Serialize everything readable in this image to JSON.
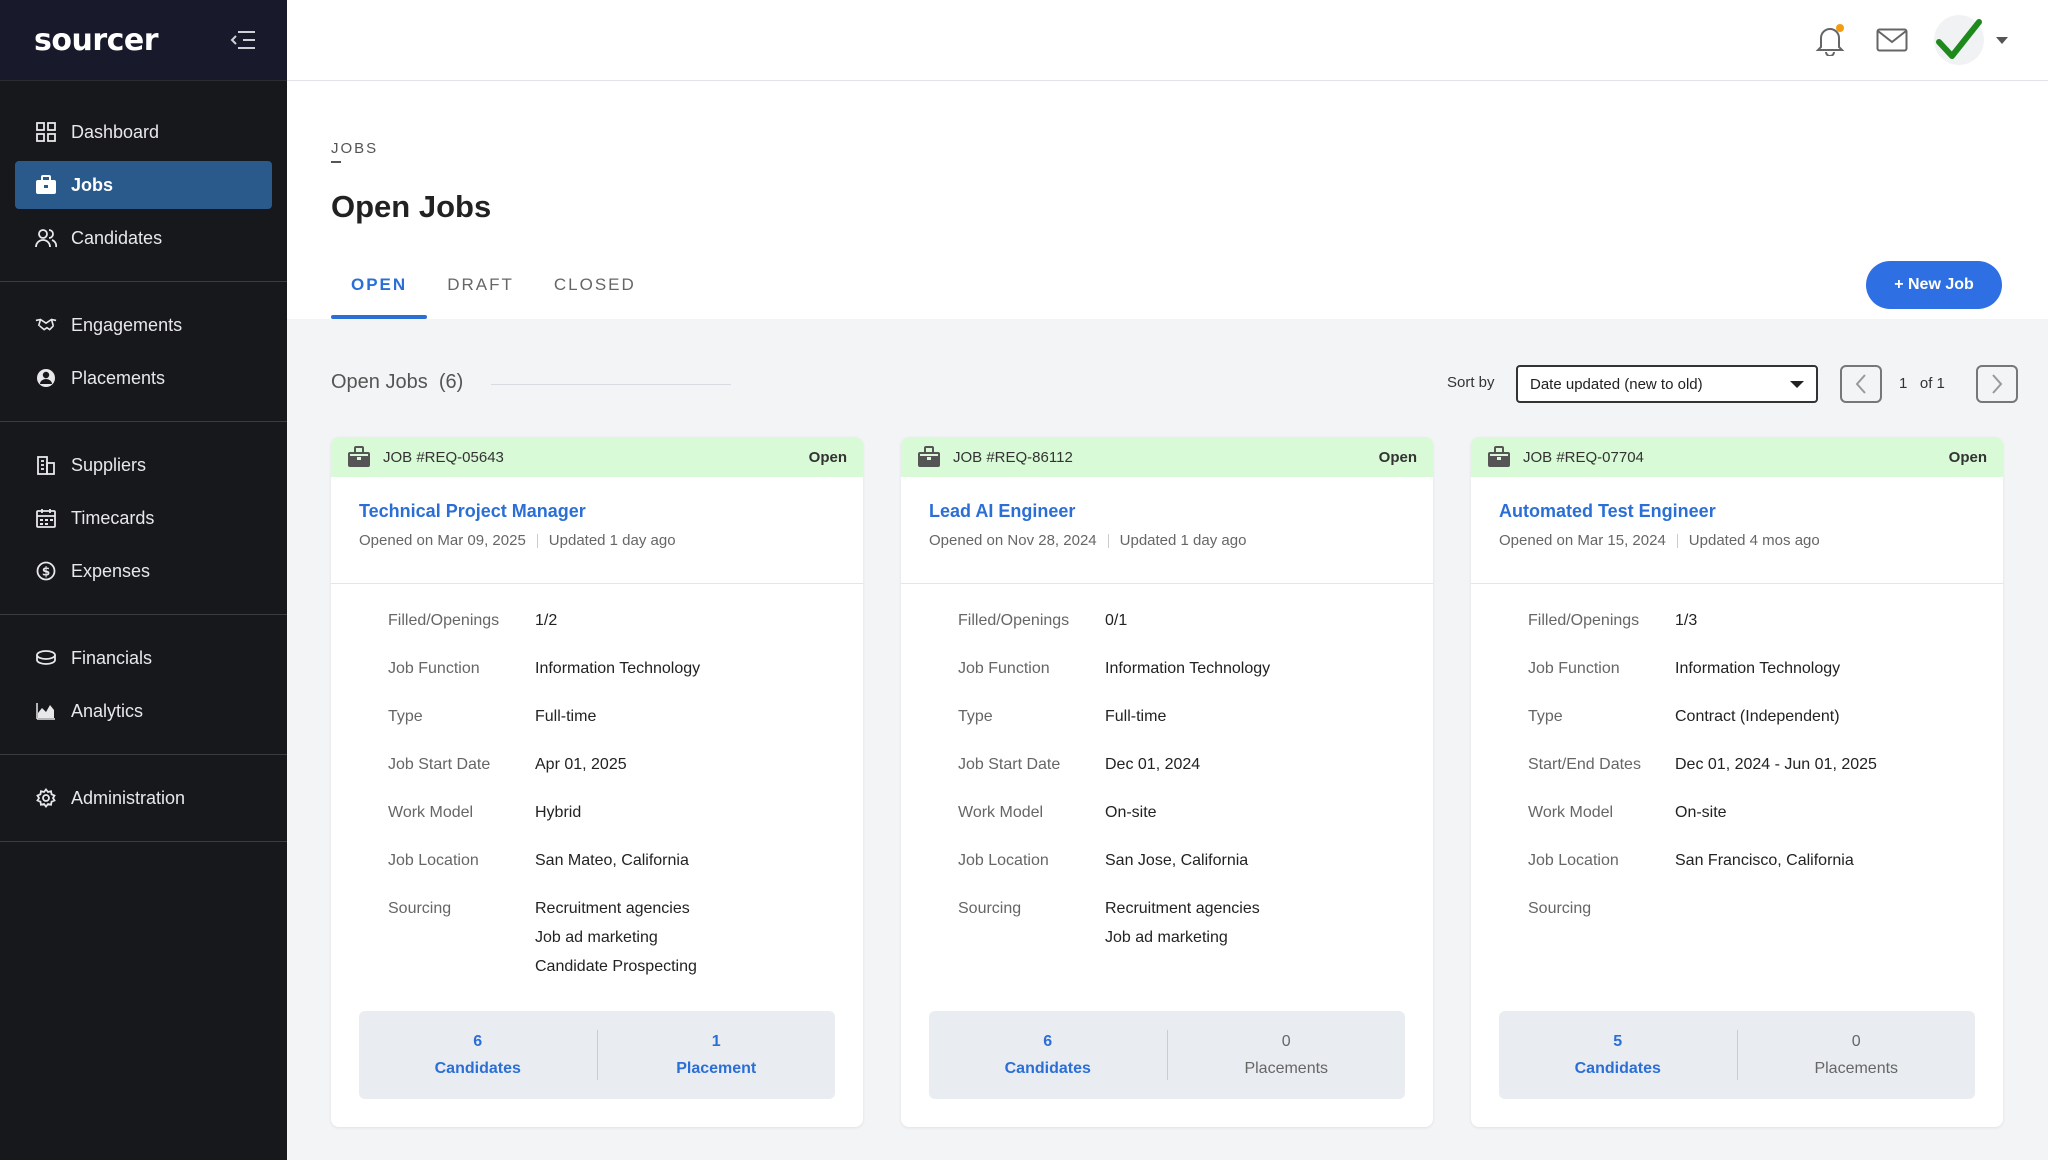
{
  "brand": {
    "name": "sourcer"
  },
  "sidebar": {
    "groups": [
      [
        {
          "label": "Dashboard",
          "icon": "grid-icon"
        },
        {
          "label": "Jobs",
          "icon": "briefcase-icon",
          "active": true
        },
        {
          "label": "Candidates",
          "icon": "users-icon"
        }
      ],
      [
        {
          "label": "Engagements",
          "icon": "handshake-icon"
        },
        {
          "label": "Placements",
          "icon": "person-circle-icon"
        }
      ],
      [
        {
          "label": "Suppliers",
          "icon": "building-icon"
        },
        {
          "label": "Timecards",
          "icon": "calendar-icon"
        },
        {
          "label": "Expenses",
          "icon": "dollar-circle-icon"
        }
      ],
      [
        {
          "label": "Financials",
          "icon": "coins-icon"
        },
        {
          "label": "Analytics",
          "icon": "area-chart-icon"
        }
      ],
      [
        {
          "label": "Administration",
          "icon": "gear-icon"
        }
      ]
    ]
  },
  "header": {
    "breadcrumb": "JOBS",
    "title": "Open Jobs",
    "tabs": [
      "OPEN",
      "DRAFT",
      "CLOSED"
    ],
    "new_job_label": "+ New Job"
  },
  "toolbar": {
    "section_title": "Open Jobs  (6)",
    "sort_label": "Sort by",
    "sort_value": "Date updated (new to old)",
    "page_current": "1",
    "page_of": "of",
    "page_total": "1"
  },
  "jobs": [
    {
      "id": "JOB #REQ-05643",
      "status": "Open",
      "title": "Technical Project Manager",
      "opened": "Opened on Mar 09, 2025",
      "updated": "Updated 1 day ago",
      "details": [
        {
          "label": "Filled/Openings",
          "value": [
            "1/2"
          ]
        },
        {
          "label": "Job Function",
          "value": [
            "Information Technology"
          ]
        },
        {
          "label": "Type",
          "value": [
            "Full-time"
          ]
        },
        {
          "label": "Job Start Date",
          "value": [
            "Apr 01, 2025"
          ]
        },
        {
          "label": "Work Model",
          "value": [
            "Hybrid"
          ]
        },
        {
          "label": "Job Location",
          "value": [
            "San Mateo, California"
          ]
        },
        {
          "label": "Sourcing",
          "value": [
            "Recruitment agencies",
            "Job ad marketing",
            "Candidate Prospecting"
          ]
        }
      ],
      "candidates_count": "6",
      "candidates_label": "Candidates",
      "placements_count": "1",
      "placements_label": "Placement",
      "placements_link": true
    },
    {
      "id": "JOB #REQ-86112",
      "status": "Open",
      "title": "Lead AI Engineer",
      "opened": "Opened on Nov 28, 2024",
      "updated": "Updated 1 day ago",
      "details": [
        {
          "label": "Filled/Openings",
          "value": [
            "0/1"
          ]
        },
        {
          "label": "Job Function",
          "value": [
            "Information Technology"
          ]
        },
        {
          "label": "Type",
          "value": [
            "Full-time"
          ]
        },
        {
          "label": "Job Start Date",
          "value": [
            "Dec 01, 2024"
          ]
        },
        {
          "label": "Work Model",
          "value": [
            "On-site"
          ]
        },
        {
          "label": "Job Location",
          "value": [
            "San Jose, California"
          ]
        },
        {
          "label": "Sourcing",
          "value": [
            "Recruitment agencies",
            "Job ad marketing"
          ]
        }
      ],
      "candidates_count": "6",
      "candidates_label": "Candidates",
      "placements_count": "0",
      "placements_label": "Placements",
      "placements_link": false
    },
    {
      "id": "JOB #REQ-07704",
      "status": "Open",
      "title": "Automated Test Engineer",
      "opened": "Opened on Mar 15, 2024",
      "updated": "Updated 4 mos ago",
      "details": [
        {
          "label": "Filled/Openings",
          "value": [
            "1/3"
          ]
        },
        {
          "label": "Job Function",
          "value": [
            "Information Technology"
          ]
        },
        {
          "label": "Type",
          "value": [
            "Contract (Independent)"
          ]
        },
        {
          "label": "Start/End Dates",
          "value": [
            "Dec 01, 2024 - Jun 01, 2025"
          ]
        },
        {
          "label": "Work Model",
          "value": [
            "On-site"
          ]
        },
        {
          "label": "Job Location",
          "value": [
            "San Francisco, California"
          ]
        },
        {
          "label": "Sourcing",
          "value": []
        }
      ],
      "candidates_count": "5",
      "candidates_label": "Candidates",
      "placements_count": "0",
      "placements_label": "Placements",
      "placements_link": false
    }
  ],
  "colors": {
    "accent": "#2b6fd6",
    "sidebar_bg": "#17181c",
    "active_nav": "#2a5a8c",
    "card_header": "#d9fad6",
    "notification_dot": "#f39c12",
    "check": "#1e8a1e"
  }
}
